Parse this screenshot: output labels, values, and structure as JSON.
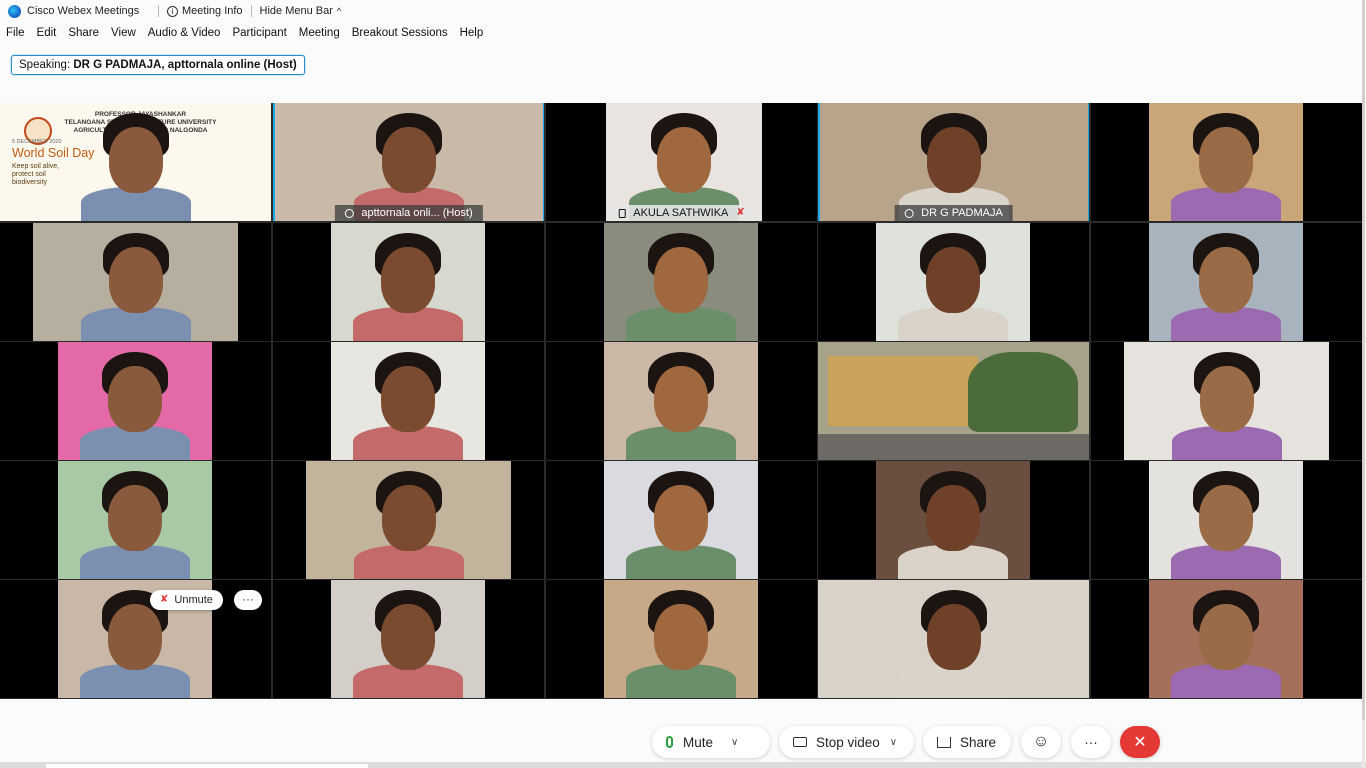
{
  "titlebar": {
    "app_name": "Cisco Webex Meetings",
    "meeting_info": "Meeting Info",
    "hide_menu": "Hide Menu Bar"
  },
  "menu": [
    "File",
    "Edit",
    "Share",
    "View",
    "Audio & Video",
    "Participant",
    "Meeting",
    "Breakout Sessions",
    "Help"
  ],
  "speaking": {
    "label": "Speaking:",
    "names": "DR G PADMAJA, apttornala online (Host)"
  },
  "slide": {
    "line1": "PROFESSOR JAYASHANKAR",
    "line2": "TELANGANA STATE AGRICULTURE UNIVERSITY",
    "line3": "AGRICULTURE POLYTECHNIC NALGONDA",
    "date": "5 DECEMBER 2020",
    "title": "World Soil Day",
    "tagline": "Keep soil alive, protect soil biodiversity"
  },
  "tiles": [
    {
      "name": "",
      "bg": "#c9c2b6"
    },
    {
      "name": "apttornala onli... (Host)",
      "bg": "#c8b9a8",
      "active": true
    },
    {
      "name": "AKULA SATHWIKA",
      "bg": "#e9e4df",
      "light": true,
      "muted": true
    },
    {
      "name": "DR G PADMAJA",
      "bg": "#b8a48a",
      "active": true
    },
    {
      "name": "",
      "bg": "#caa57a"
    },
    {
      "name": "",
      "bg": "#b6ae9f"
    },
    {
      "name": "",
      "bg": "#d7d9cf"
    },
    {
      "name": "",
      "bg": "#8a8d7e"
    },
    {
      "name": "",
      "bg": "#dfe1dc"
    },
    {
      "name": "",
      "bg": "#a9b3bd"
    },
    {
      "name": "",
      "bg": "#e36aa7"
    },
    {
      "name": "",
      "bg": "#e8e6e1"
    },
    {
      "name": "",
      "bg": "#cbb7a6"
    },
    {
      "name": "",
      "bg": "#a7a28a"
    },
    {
      "name": "",
      "bg": "#e6e3de"
    },
    {
      "name": "",
      "bg": "#a8c8a6"
    },
    {
      "name": "",
      "bg": "#c2b49c"
    },
    {
      "name": "",
      "bg": "#d9dbe0"
    },
    {
      "name": "",
      "bg": "#6a4e40"
    },
    {
      "name": "",
      "bg": "#e4e2de"
    },
    {
      "name": "",
      "bg": "#c9b7a8"
    },
    {
      "name": "",
      "bg": "#d3cfc8"
    },
    {
      "name": "",
      "bg": "#c7a98a"
    },
    {
      "name": "",
      "bg": "#d8d2c8"
    },
    {
      "name": "",
      "bg": "#a4705a"
    }
  ],
  "unmute": {
    "label": "Unmute",
    "more": "···"
  },
  "controls": {
    "mute": "Mute",
    "stop_video": "Stop video",
    "share": "Share",
    "more": "···",
    "end": "✕"
  },
  "colors": {
    "accent": "#21a8e6",
    "end_call": "#e53935",
    "mic_green": "#2a9d3c"
  }
}
